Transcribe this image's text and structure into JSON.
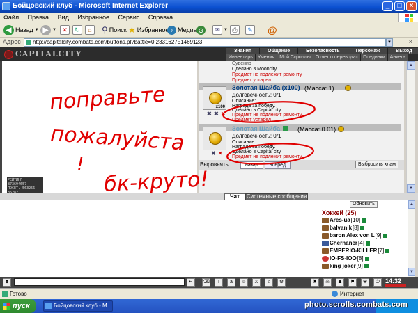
{
  "window": {
    "title": "Бойцовский клуб - Microsoft Internet Explorer"
  },
  "menu": [
    "Файл",
    "Правка",
    "Вид",
    "Избранное",
    "Сервис",
    "Справка"
  ],
  "toolbar": {
    "back": "Назад",
    "search": "Поиск",
    "favorites": "Избранное",
    "media": "Медиа"
  },
  "address": {
    "label": "Адрес",
    "url": "http://capitalcity.combats.com/buttons.pl?battle=0.233162751469123"
  },
  "game": {
    "logo": "CAPITALCITY",
    "nav_top": [
      "Знания",
      "Общение",
      "Безопасность",
      "Персонаж",
      "Выход"
    ],
    "nav_bottom": [
      "Инвентарь",
      "Умения",
      "Мой Скроллы",
      "Отчет о переводах",
      "Поединки",
      "Анкета"
    ]
  },
  "rating": {
    "line1": "РЕЙТИНГ 873694657",
    "line2": "ПОСЕТ. 563256",
    "line3": "36282"
  },
  "inventory": {
    "prev_item": {
      "line1": "Сувенир",
      "made_in": "Сделано в Mooncity",
      "no_repair": "Предмет не подлежит ремонту",
      "outdated": "Предмет устарел"
    },
    "items": [
      {
        "name": "Золотая Шайба (x100)",
        "mass": "(Масса: 1)",
        "durability": "Долговечность: 0/1",
        "desc_label": "Описание:",
        "desc": "Награда за победу.",
        "made_in": "Сделано в Capital city",
        "no_repair": "Предмет не подлежит ремонту",
        "outdated": "Предмет устарел",
        "qty": "x100"
      },
      {
        "name": "Золотая Шайба",
        "mass": "(Масса: 0.01)",
        "durability": "Долговечность: 0/1",
        "desc_label": "Описание:",
        "desc": "Награда за победу.",
        "made_in": "Сделано в Capital city",
        "no_repair": "Предмет не подлежит ремонту"
      }
    ],
    "bottom_label": "Выровнять",
    "tabs": [
      "назад",
      "вперед"
    ],
    "throw_button": "Выбросить хлам"
  },
  "chat": {
    "tab_chat": "Чат",
    "tab_system": "Системные сообщения"
  },
  "users": {
    "refresh": "Обновить",
    "room": "Хоккей (25)",
    "list": [
      {
        "name": "Ares-ua",
        "level": "[10]"
      },
      {
        "name": "balvanik",
        "level": "[8]"
      },
      {
        "name": "baron Alex von L",
        "level": "[9]"
      },
      {
        "name": "Chernaner",
        "level": "[4]"
      },
      {
        "name": "EMPERIO-KILLER",
        "level": "[7]"
      },
      {
        "name": "IO-FS-IOO",
        "level": "[8]"
      },
      {
        "name": "king joker",
        "level": "[9]"
      }
    ]
  },
  "clock": "14:32",
  "status": {
    "text": "Готово",
    "zone": "Интернет"
  },
  "taskbar": {
    "start": "пуск",
    "item": "Бойцовский клуб - M..."
  },
  "watermark": "photo.scrolls.combats.com",
  "handwriting": {
    "line1": "поправьте",
    "line2": "пожалуйста",
    "line3": "!",
    "line4": "бк-круто!"
  },
  "colors": {
    "accent_red": "#e00000",
    "title_blue": "#0a4fd0",
    "item_name": "#003c80"
  }
}
